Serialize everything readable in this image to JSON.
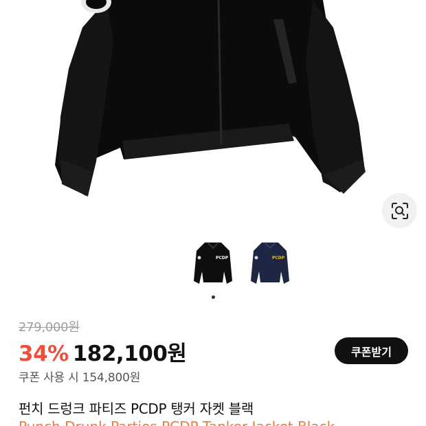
{
  "product": {
    "image_alt": "product-photo",
    "thumbnails": [
      {
        "name": "black"
      },
      {
        "name": "navy"
      }
    ],
    "thumbnail_logo": "PCDP",
    "active_thumbnail": 1,
    "original_price": "279,000원",
    "discount": "34%",
    "price": "182,100원",
    "coupon_button": "쿠폰받기",
    "coupon_price": "쿠폰 사용 시 154,800원",
    "title": "펀치 드렁크 파티즈 PCDP 탱커 자켓 블랙",
    "subtitle_partial": "Punch Drunk Parties PCDP Tanker Jacket Black"
  },
  "colors": {
    "discount": "#ef4e3a",
    "button_bg": "#111111",
    "navy": "#1d2744",
    "logo_yellow": "#f2c200"
  },
  "icons": {
    "lens": "visual-search-icon"
  }
}
